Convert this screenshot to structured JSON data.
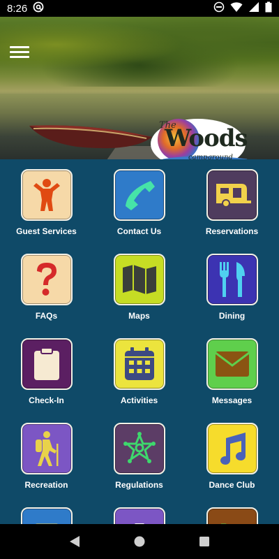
{
  "status_bar": {
    "time": "8:26"
  },
  "header": {
    "logo_text_the": "The",
    "logo_text_woods": "Woods",
    "logo_text_campground": "campground"
  },
  "tiles": [
    {
      "label": "Guest Services",
      "icon": "person-icon",
      "bg": "#f6d9a8",
      "fg": "#e04a12"
    },
    {
      "label": "Contact Us",
      "icon": "phone-icon",
      "bg": "#2f7bc9",
      "fg": "#46e3a8"
    },
    {
      "label": "Reservations",
      "icon": "camper-icon",
      "bg": "#4f3c5e",
      "fg": "#f1d24b"
    },
    {
      "label": "FAQs",
      "icon": "question-icon",
      "bg": "#f6d9a8",
      "fg": "#d52a2a"
    },
    {
      "label": "Maps",
      "icon": "map-icon",
      "bg": "#c6dd24",
      "fg": "#3a3f3a"
    },
    {
      "label": "Dining",
      "icon": "fork-knife-icon",
      "bg": "#3c33b2",
      "fg": "#4fd1f0"
    },
    {
      "label": "Check-In",
      "icon": "clipboard-icon",
      "bg": "#5b1f62",
      "fg": "#f6ead2"
    },
    {
      "label": "Activities",
      "icon": "calendar-icon",
      "bg": "#ece43d",
      "fg": "#3d4a82"
    },
    {
      "label": "Messages",
      "icon": "envelope-icon",
      "bg": "#5fcf4c",
      "fg": "#8a5412"
    },
    {
      "label": "Recreation",
      "icon": "hiker-icon",
      "bg": "#7c56c4",
      "fg": "#e8d24a"
    },
    {
      "label": "Regulations",
      "icon": "sheriff-star-icon",
      "bg": "#5c3d66",
      "fg": "#3ed86d"
    },
    {
      "label": "Dance Club",
      "icon": "music-note-icon",
      "bg": "#f6dc2c",
      "fg": "#4a62b8"
    },
    {
      "label": "",
      "icon": "partial-tile-1-icon",
      "bg": "#2f7bc9",
      "fg": "#f1d24b"
    },
    {
      "label": "",
      "icon": "partial-tile-2-icon",
      "bg": "#7c56c4",
      "fg": "#ffffff"
    },
    {
      "label": "",
      "icon": "partial-tile-3-icon",
      "bg": "#8a4a16",
      "fg": "#4fd14c"
    }
  ]
}
